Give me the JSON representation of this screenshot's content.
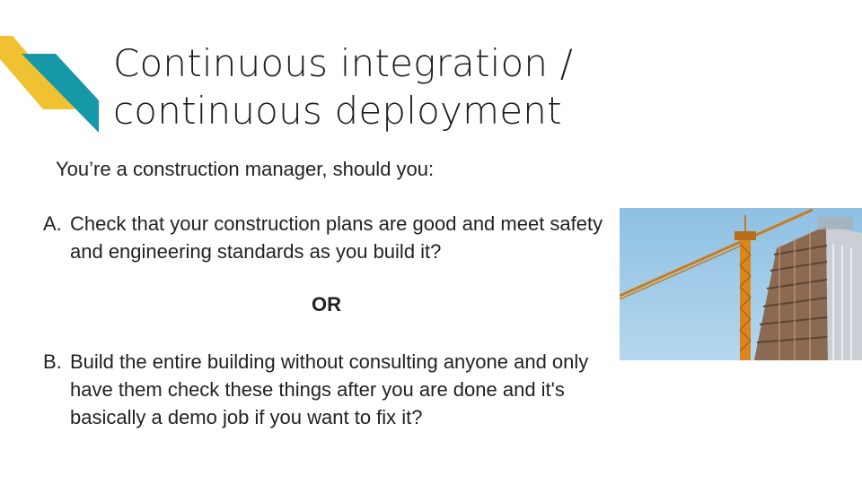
{
  "slide": {
    "title_line1": "Continuous integration /",
    "title_line2": "continuous deployment",
    "intro": "You’re a construction manager, should you:",
    "options": [
      {
        "letter": "A.",
        "text": "Check that your construction plans are good and meet safety and engineering standards as you build it?"
      },
      {
        "letter": "B.",
        "text": "Build the entire building without consulting anyone and only have them check these things after you are done and it's basically a demo job if you want to fix it?"
      }
    ],
    "separator": "OR"
  },
  "colors": {
    "accent_yellow": "#F0C232",
    "accent_teal": "#1598A8",
    "sky": "#9CC8E6",
    "crane": "#D9861E"
  },
  "image": {
    "subject": "building under construction with crane"
  }
}
